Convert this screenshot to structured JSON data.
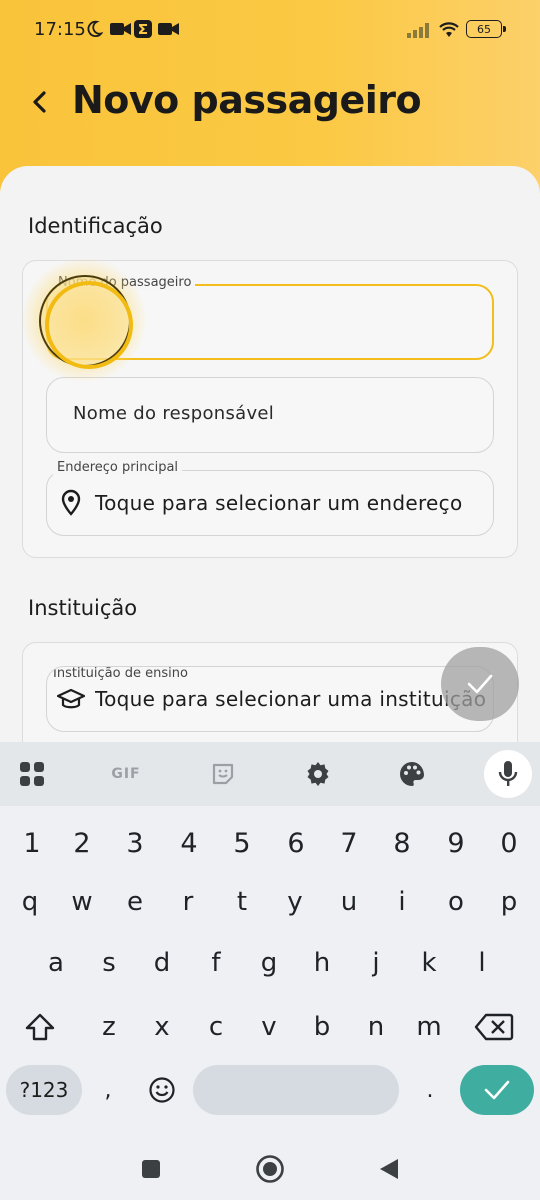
{
  "status_bar": {
    "time": "17:15",
    "battery": "65",
    "icons": [
      "moon-icon",
      "video-camera-icon",
      "sigma-app-icon",
      "video-camera-icon",
      "signal-icon",
      "wifi-icon",
      "battery-icon"
    ]
  },
  "header": {
    "back_icon": "chevron-left-icon",
    "title": "Novo passageiro"
  },
  "identificacao": {
    "title": "Identificação",
    "passenger_name": {
      "label": "Nome do passageiro",
      "value": ""
    },
    "guardian_name": {
      "placeholder": "Nome do responsável"
    },
    "address": {
      "label": "Endereço principal",
      "icon": "location-pin-icon",
      "value": "Toque para selecionar um endereço"
    }
  },
  "instituicao": {
    "title": "Instituição",
    "school": {
      "label": "Instituição de ensino",
      "icon": "graduation-cap-icon",
      "value": "Toque para selecionar uma instituição"
    }
  },
  "fab": {
    "icon": "check-icon"
  },
  "keyboard": {
    "toolbar": [
      "apps-grid-icon",
      "gif-icon",
      "sticker-icon",
      "settings-gear-icon",
      "palette-icon",
      "microphone-icon"
    ],
    "gif_label": "GIF",
    "row_numbers": [
      "1",
      "2",
      "3",
      "4",
      "5",
      "6",
      "7",
      "8",
      "9",
      "0"
    ],
    "row_q": [
      "q",
      "w",
      "e",
      "r",
      "t",
      "y",
      "u",
      "i",
      "o",
      "p"
    ],
    "row_a": [
      "a",
      "s",
      "d",
      "f",
      "g",
      "h",
      "j",
      "k",
      "l"
    ],
    "row_z": [
      "z",
      "x",
      "c",
      "v",
      "b",
      "n",
      "m"
    ],
    "symbols_key": "?123",
    "comma": ",",
    "period": ".",
    "accent": "#3fada0"
  },
  "nav_bar": [
    "square-recents-icon",
    "circle-home-icon",
    "triangle-back-icon"
  ],
  "colors": {
    "header": "#fbc944",
    "focus": "#f3bd1b"
  }
}
